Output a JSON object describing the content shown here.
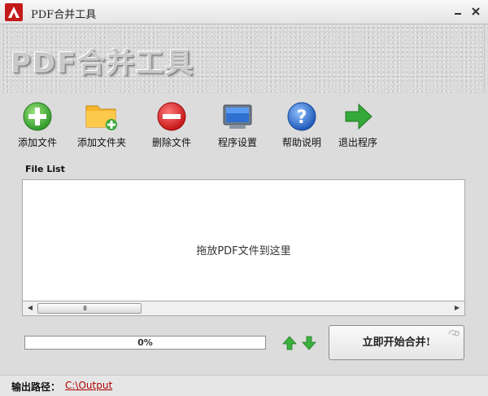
{
  "window": {
    "title": "PDF合并工具"
  },
  "banner": {
    "title": "PDF合并工具"
  },
  "toolbar": {
    "items": [
      {
        "label": "添加文件",
        "icon": "add-file-icon"
      },
      {
        "label": "添加文件夹",
        "icon": "add-folder-icon"
      },
      {
        "label": "删除文件",
        "icon": "delete-icon"
      },
      {
        "label": "程序设置",
        "icon": "settings-monitor-icon"
      },
      {
        "label": "帮助说明",
        "icon": "help-icon"
      },
      {
        "label": "退出程序",
        "icon": "exit-arrow-icon"
      }
    ]
  },
  "file_list": {
    "label": "File List",
    "drop_hint": "拖放PDF文件到这里",
    "scroll_grip": "III"
  },
  "progress": {
    "value": 0,
    "text": "0%"
  },
  "merge_button": {
    "label": "立即开始合并!"
  },
  "status": {
    "label": "输出路径：",
    "path": "C:\\Output"
  },
  "colors": {
    "accent_green": "#3ca046",
    "path_red": "#b00000",
    "delete_red": "#d42424",
    "help_blue": "#2a66c8"
  }
}
